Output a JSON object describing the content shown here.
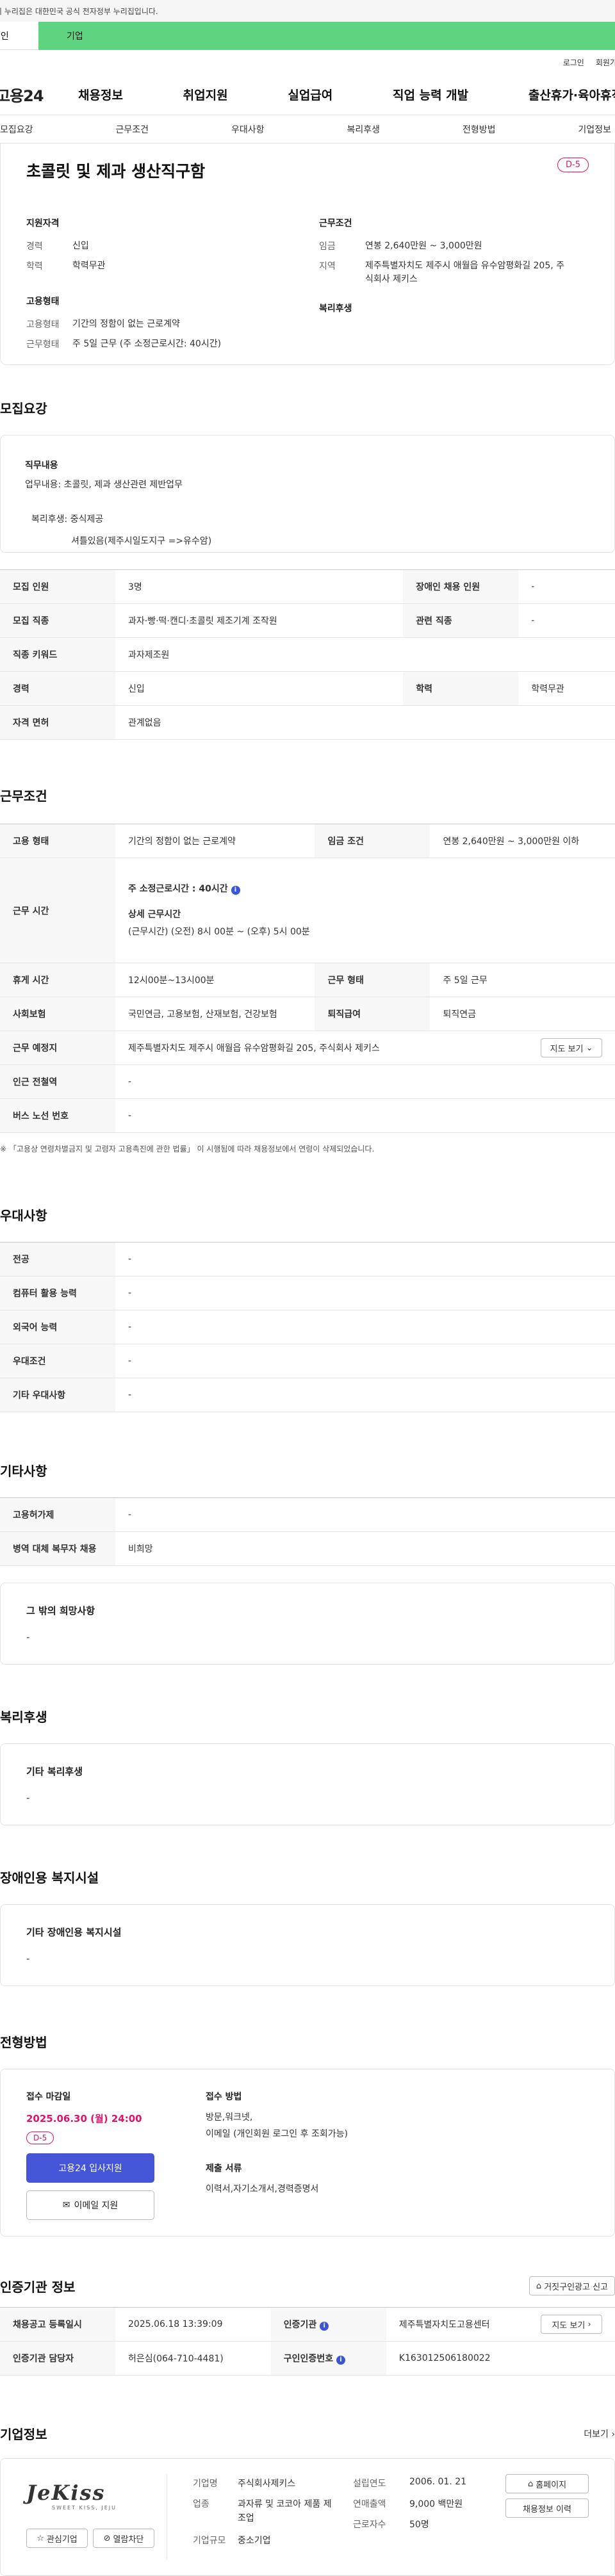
{
  "gov": {
    "notice": "이 누리집은 대한민국 공식 전자정부 누리집입니다."
  },
  "tabs": {
    "individual": "개인",
    "enterprise": "기업"
  },
  "util": {
    "login": "로그인",
    "signup": "회원가입"
  },
  "gnb": {
    "logo": "고용24",
    "menu": [
      "채용정보",
      "취업지원",
      "실업급여",
      "직업 능력 개발",
      "출산휴가·육아휴직"
    ]
  },
  "subnav": [
    "모집요강",
    "근무조건",
    "우대사항",
    "복리후생",
    "전형방법",
    "기업정보"
  ],
  "summary": {
    "title": "초콜릿 및 제과 생산직구함",
    "dday": "D-5",
    "qual_h": "지원자격",
    "career_k": "경력",
    "career_v": "신입",
    "edu_k": "학력",
    "edu_v": "학력무관",
    "emp_h": "고용형태",
    "emptype_k": "고용형태",
    "emptype_v": "기간의 정함이 없는 근로계약",
    "worktime_k": "근무형태",
    "worktime_v": "주 5일 근무 (주 소정근로시간: 40시간)",
    "cond_h": "근무조건",
    "wage_k": "임금",
    "wage_v": "연봉 2,640만원 ~ 3,000만원",
    "region_k": "지역",
    "region_v": "제주특별자치도 제주시 애월읍 유수암평화길 205, 주식회사 제키스",
    "welfare_h": "복리후생"
  },
  "recruit": {
    "title": "모집요강",
    "job_h": "직무내용",
    "duty": "업무내용: 초콜릿, 제과 생산관련 제반업무",
    "welfare": "복리후생: 중식제공",
    "commute": "셔틀있음(제주시일도지구 =>유수암)",
    "table": [
      [
        "모집 인원",
        "3명",
        "장애인 채용 인원",
        "-"
      ],
      [
        "모집 직종",
        "과자·빵·떡·캔디·초콜릿 제조기계 조작원",
        "관련 직종",
        "-"
      ],
      [
        "직종 키워드",
        "과자제조원"
      ],
      [
        "경력",
        "신입",
        "학력",
        "학력무관"
      ],
      [
        "자격 면허",
        "관계없음"
      ]
    ]
  },
  "work": {
    "title": "근무조건",
    "emptype_k": "고용 형태",
    "emptype_v": "기간의 정함이 없는 근로계약",
    "wage_k": "임금 조건",
    "wage_v": "연봉 2,640만원 ~ 3,000만원 이하",
    "hours_k": "근무 시간",
    "hours_l1": "주 소정근로시간 : 40시간",
    "hours_l2": "상세 근무시간",
    "hours_l3": "(근무시간) (오전) 8시 00분 ~ (오후) 5시 00분",
    "break_k": "휴게 시간",
    "break_v": "12시00분~13시00분",
    "form_k": "근무 형태",
    "form_v": "주 5일 근무",
    "ins_k": "사회보험",
    "ins_v": "국민연금, 고용보험, 산재보험, 건강보험",
    "retire_k": "퇴직급여",
    "retire_v": "퇴직연금",
    "place_k": "근무 예정지",
    "place_v": "제주특별자치도 제주시 애월읍 유수암평화길 205, 주식회사 제키스",
    "map_btn": "지도 보기",
    "subway_k": "인근 전철역",
    "subway_v": "-",
    "bus_k": "버스 노선 번호",
    "bus_v": "-",
    "note": "※ 「고용상 연령차별금지 및 고령자 고용촉진에 관한 법률」 이 시행됨에 따라 채용정보에서 연령이 삭제되었습니다."
  },
  "pref": {
    "title": "우대사항",
    "rows": [
      [
        "전공",
        "-"
      ],
      [
        "컴퓨터 활용 능력",
        "-"
      ],
      [
        "외국어 능력",
        "-"
      ],
      [
        "우대조건",
        "-"
      ],
      [
        "기타 우대사항",
        "-"
      ]
    ]
  },
  "etc": {
    "title": "기타사항",
    "rows": [
      [
        "고용허가제",
        "-"
      ],
      [
        "병역 대체 복무자 채용",
        "비희망"
      ]
    ],
    "box_t": "그 밖의 희망사항",
    "box_d": "-"
  },
  "welfare": {
    "title": "복리후생",
    "box_t": "기타 복리후생",
    "box_d": "-"
  },
  "disab": {
    "title": "장애인용 복지시설",
    "box_t": "기타 장애인용 복지시설",
    "box_d": "-"
  },
  "select": {
    "title": "전형방법",
    "deadline_h": "접수 마감일",
    "deadline": "2025.06.30 (월) 24:00",
    "dday": "D-5",
    "apply_btn": "고용24 입사지원",
    "email_btn": "이메일 지원",
    "method_h": "접수 방법",
    "method_v1": "방문,워크넷,",
    "method_v2": "이메일 (개인회원 로그인 후 조회가능)",
    "docs_h": "제출 서류",
    "docs_v": "이력서,자기소개서,경력증명서"
  },
  "cert": {
    "title": "인증기관 정보",
    "report_btn": "거짓구인광고 신고",
    "reg_k": "채용공고 등록일시",
    "reg_v": "2025.06.18 13:39:09",
    "org_k": "인증기관",
    "org_v": "제주특별자치도고용센터",
    "map_btn": "지도 보기",
    "mgr_k": "인증기관 담당자",
    "mgr_v": "허은심(064-710-4481)",
    "num_k": "구인인증번호",
    "num_v": "K163012506180022"
  },
  "company": {
    "title": "기업정보",
    "more": "더보기",
    "logo_text": "JeKiss",
    "logo_sub": "SWEET KISS, JEJU",
    "fav_btn": "관심기업",
    "block_btn": "열람차단",
    "name_k": "기업명",
    "name_v": "주식회사제키스",
    "ind_k": "업종",
    "ind_v": "과자류 및 코코아 제품 제조업",
    "size_k": "기업규모",
    "size_v": "중소기업",
    "est_k": "설립연도",
    "est_v": "2006. 01. 21",
    "sales_k": "연매출액",
    "sales_v": "9,000 백만원",
    "emp_k": "근로자수",
    "emp_v": "50명",
    "home_btn": "홈페이지",
    "hire_btn": "채용정보 이력"
  }
}
